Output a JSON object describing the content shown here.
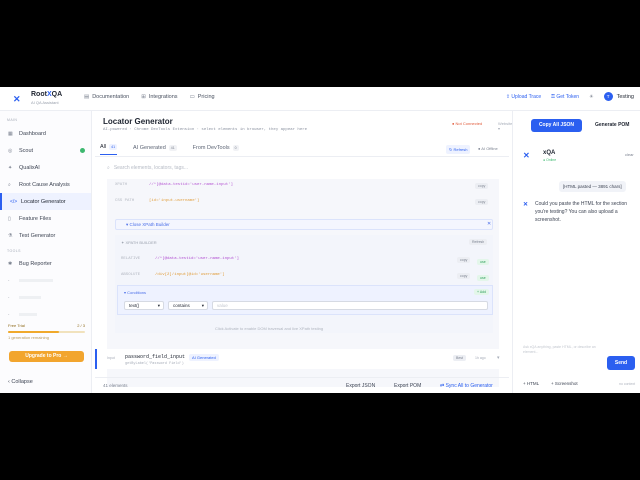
{
  "brand": {
    "name": "Root",
    "name_x": "X",
    "name_tail": "QA",
    "tagline": "AI QA Assistant"
  },
  "nav": [
    "Documentation",
    "Integrations",
    "Pricing"
  ],
  "topright": {
    "upload": "Upload Trace",
    "token": "Get Token",
    "user_initial": "T",
    "user": "Testing"
  },
  "sidebar": {
    "section_main": "MAIN",
    "items": [
      {
        "label": "Dashboard",
        "icon": "grid-icon"
      },
      {
        "label": "Scout",
        "icon": "compass-icon"
      },
      {
        "label": "QualixAI",
        "icon": "sparkle-icon"
      },
      {
        "label": "Root Cause Analysis",
        "icon": "search-icon"
      },
      {
        "label": "Locator Generator",
        "icon": "code-icon"
      },
      {
        "label": "Feature Files",
        "icon": "file-icon"
      },
      {
        "label": "Test Generator",
        "icon": "flask-icon"
      }
    ],
    "section_tools": "TOOLS",
    "tools": [
      {
        "label": "Bug Reporter",
        "icon": "bug-icon"
      }
    ],
    "trial_label": "Free Trial",
    "trial_count": "2 / 3",
    "trial_note": "1 generation remaining",
    "upgrade": "Upgrade to Pro →",
    "collapse": "Collapse"
  },
  "page": {
    "title": "Locator Generator",
    "subtitle": "AI-powered · Chrome DevTools Extension · select elements in browser, they appear here",
    "status": "● Not Connected",
    "status2": "Website ▾",
    "tabs": [
      {
        "label": "All",
        "count": "41"
      },
      {
        "label": "AI Generated",
        "count": "41"
      },
      {
        "label": "From DevTools",
        "count": "0"
      }
    ],
    "refresh": "↻ Refresh",
    "offline": "● AI Offline",
    "search_placeholder": "Search elements, locators, tags..."
  },
  "locators": [
    {
      "label": "XPATH",
      "value": "//*[@data-testid='user-name-input']",
      "color": "#b14ed1"
    },
    {
      "label": "CSS PATH",
      "value": "[id='input-username']",
      "color": "#e09b36"
    }
  ],
  "xpath_toggle": "▾ Close XPath Builder",
  "builder": {
    "title": "✦ XPATH BUILDER",
    "refresh": "Refresh",
    "rows": [
      {
        "label": "RELATIVE",
        "value": "//*[@data-testid='user-name-input']"
      },
      {
        "label": "ABSOLUTE",
        "value": "/div[2]/input[@id='username']"
      }
    ],
    "conditions": "▾ Conditions",
    "add": "+ Add",
    "cond_fn": "text()",
    "cond_op": "contains",
    "hint": "Click Activate to enable DOM traversal and live XPath testing"
  },
  "element": {
    "kind": "Input",
    "name": "password_field_input",
    "tag": "AI Generated",
    "sub": "getByLabel('Password Field')",
    "score": "Best",
    "age": "1h ago"
  },
  "footer": {
    "count": "41 elements",
    "export_json": "Export JSON",
    "export_pom": "Export POM",
    "sync": "⇄ Sync All to Generator"
  },
  "actions": {
    "copy": "Copy All JSON",
    "pom": "Generate POM"
  },
  "chat": {
    "title": "xQA",
    "online": "● Online",
    "clear": "clear",
    "user_msg": "[HTML pasted — 3891 chars]",
    "bot_msg": "Could you paste the HTML for the section you're testing? You can also upload a screenshot.",
    "input_placeholder": "Ask xQA anything, paste HTML, or describe an element...",
    "send": "Send",
    "html": "+ HTML",
    "screenshot": "+ Screenshot",
    "conn": "no context"
  }
}
